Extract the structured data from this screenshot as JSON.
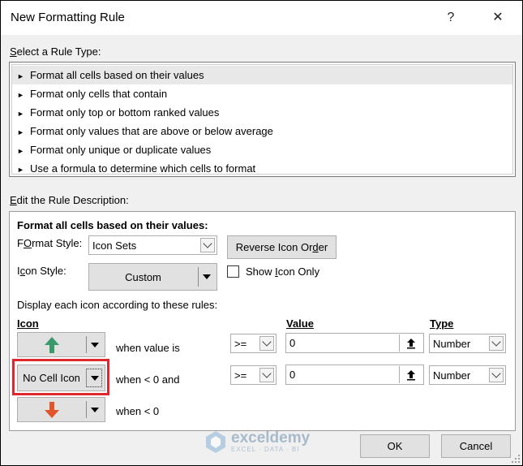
{
  "window": {
    "title": "New Formatting Rule",
    "help": "?",
    "close": "✕"
  },
  "select_type": {
    "label_u": "S",
    "label_rest": "elect a Rule Type:",
    "items": [
      "Format all cells based on their values",
      "Format only cells that contain",
      "Format only top or bottom ranked values",
      "Format only values that are above or below average",
      "Format only unique or duplicate values",
      "Use a formula to determine which cells to format"
    ],
    "selected_index": 0,
    "bullet": "►"
  },
  "edit_rule": {
    "label_u": "E",
    "label_rest": "dit the Rule Description:",
    "heading": "Format all cells based on their values:",
    "format_style_label_u": "O",
    "format_style_label_pre": "F",
    "format_style_label_rest": "rmat Style:",
    "format_style_value": "Icon Sets",
    "reverse_btn_pre": "Reverse Icon Or",
    "reverse_btn_u": "d",
    "reverse_btn_rest": "er",
    "icon_style_label_pre": "I",
    "icon_style_label_u": "c",
    "icon_style_label_rest": "on Style:",
    "icon_style_value": "Custom",
    "show_icon_only_pre": "Show ",
    "show_icon_only_u": "I",
    "show_icon_only_rest": "con Only",
    "show_icon_only_checked": false,
    "display_rules_label": "Display each icon according to these rules:",
    "col_icon": "Icon",
    "col_value": "Value",
    "col_type": "Type",
    "rules": [
      {
        "icon": "green-up-arrow",
        "icon_text": "",
        "when_text": "when value is",
        "operator": ">=",
        "value": "0",
        "type": "Number"
      },
      {
        "icon": "no-cell-icon",
        "icon_text": "No Cell Icon",
        "when_text": "when < 0 and",
        "operator": ">=",
        "value": "0",
        "type": "Number"
      },
      {
        "icon": "red-down-arrow",
        "icon_text": "",
        "when_text": "when < 0"
      }
    ]
  },
  "footer": {
    "ok": "OK",
    "cancel": "Cancel"
  },
  "watermark": {
    "name": "exceldemy",
    "tagline": "EXCEL · DATA · BI"
  },
  "colors": {
    "highlight_red": "#e0262e",
    "green_arrow": "#3a9a6c",
    "red_arrow": "#e2552a"
  }
}
